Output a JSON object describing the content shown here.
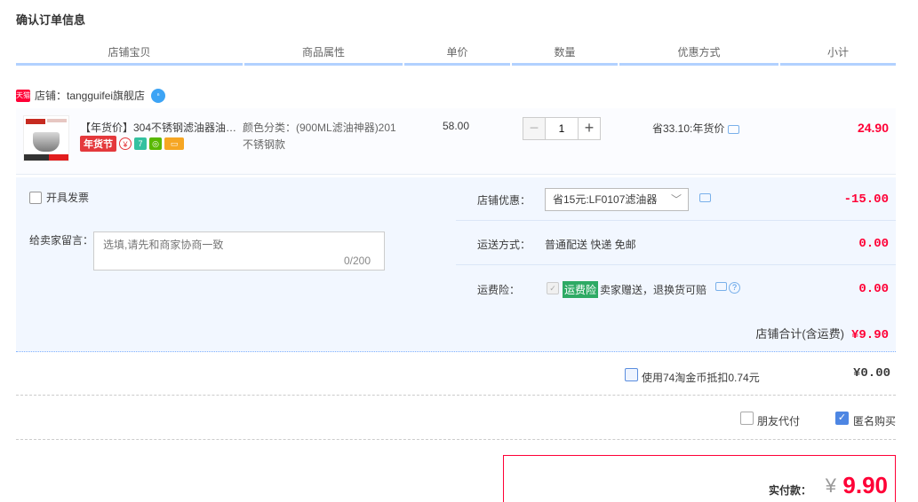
{
  "page": {
    "title": "确认订单信息"
  },
  "columns": [
    "店铺宝贝",
    "商品属性",
    "单价",
    "数量",
    "优惠方式",
    "小计"
  ],
  "shop": {
    "badge": "天猫",
    "name": "店铺：tangguifei旗舰店",
    "ww_icon": "wangwang-icon"
  },
  "item": {
    "title": "【年货价】304不锈钢滤油器油…",
    "promo_badge": "年货节",
    "icons": [
      "yuan-icon",
      "seven-day-return-icon",
      "guarantee-icon",
      "card-icon"
    ],
    "attr": "颜色分类：(900ML滤油神器)201不锈钢款",
    "price": "58.00",
    "quantity": "1",
    "discount": "省33.10:年货价",
    "subtotal": "24.90"
  },
  "options": {
    "invoice_label": "开具发票",
    "memo_label": "给卖家留言：",
    "memo_placeholder": "选填,请先和商家协商一致",
    "memo_count": "0/200",
    "shop_discount_label": "店铺优惠：",
    "shop_discount_value": "省15元:LF0107滤油器",
    "shop_discount_amount": "-15.00",
    "shipping_label": "运送方式：",
    "shipping_value": "普通配送 快递 免邮",
    "shipping_amount": "0.00",
    "insurance_label": "运费险：",
    "insurance_badge": "运费险",
    "insurance_text": "卖家赠送，退换货可赔",
    "insurance_amount": "0.00",
    "shop_total_label": "店铺合计(含运费)",
    "shop_total_amount": "¥9.90"
  },
  "coins": {
    "label": "使用74淘金币抵扣0.74元",
    "amount": "¥0.00"
  },
  "pay_options": {
    "friend_pay": "朋友代付",
    "anonymous": "匿名购买",
    "anonymous_checked": true
  },
  "final": {
    "label": "实付款：",
    "currency": "¥",
    "amount": "9.90"
  },
  "colors": {
    "accent_red": "#ff0036",
    "panel_bg": "#f2f7ff",
    "header_line": "#b2d1ff"
  }
}
